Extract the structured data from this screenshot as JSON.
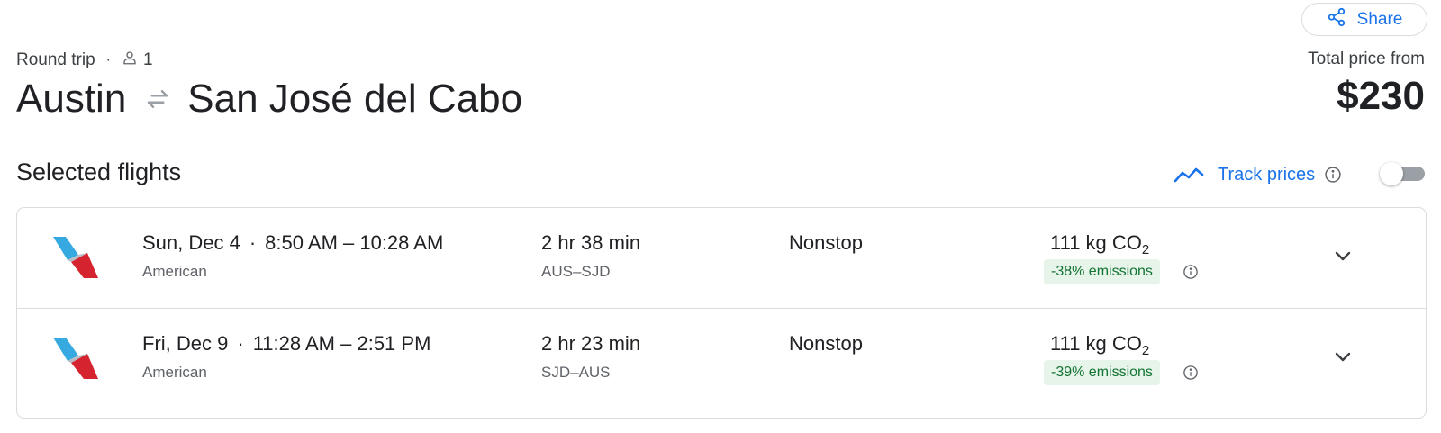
{
  "header": {
    "share_label": "Share",
    "trip_type": "Round trip",
    "separator": "·",
    "passengers": "1",
    "origin": "Austin",
    "destination": "San José del Cabo",
    "price_label": "Total price from",
    "price": "$230"
  },
  "section": {
    "title": "Selected flights",
    "track_label": "Track prices",
    "track_enabled": false
  },
  "flights": [
    {
      "date": "Sun, Dec 4",
      "dot": "·",
      "times": "8:50 AM – 10:28 AM",
      "airline": "American",
      "duration": "2 hr 38 min",
      "airports": "AUS–SJD",
      "stops": "Nonstop",
      "co2_value": "111 kg CO",
      "co2_sub": "2",
      "emissions": "-38% emissions"
    },
    {
      "date": "Fri, Dec 9",
      "dot": "·",
      "times": "11:28 AM – 2:51 PM",
      "airline": "American",
      "duration": "2 hr 23 min",
      "airports": "SJD–AUS",
      "stops": "Nonstop",
      "co2_value": "111 kg CO",
      "co2_sub": "2",
      "emissions": "-39% emissions"
    }
  ],
  "icons": {
    "share": "share-icon",
    "person": "person-icon",
    "swap": "swap-arrows-icon",
    "trend": "trend-line-icon",
    "info": "info-icon",
    "chevron": "chevron-down-icon",
    "airline_logo": "american-airlines-logo"
  },
  "colors": {
    "accent": "#1a73e8",
    "emissions_bg": "#e6f4ea",
    "emissions_text": "#137333",
    "border": "#dadce0"
  }
}
